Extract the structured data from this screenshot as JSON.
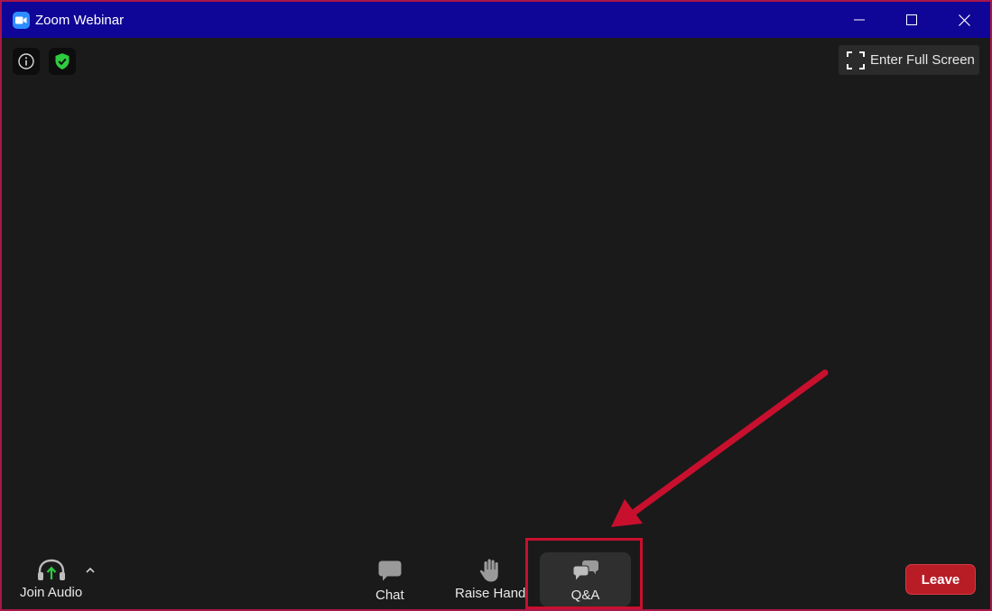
{
  "window": {
    "title": "Zoom Webinar"
  },
  "top_bar": {
    "fullscreen_label": "Enter Full Screen"
  },
  "toolbar": {
    "join_audio_label": "Join Audio",
    "chat_label": "Chat",
    "raise_hand_label": "Raise Hand",
    "qa_label": "Q&A",
    "leave_label": "Leave"
  },
  "icons": {
    "app": "zoom-camera-icon",
    "info": "info-icon",
    "security": "shield-check-icon",
    "fullscreen": "fullscreen-icon",
    "audio": "headphones-icon",
    "chat": "chat-icon",
    "raise_hand": "hand-icon",
    "qa": "qa-icon"
  },
  "colors": {
    "titlebar": "#0f0596",
    "background": "#1a1a1a",
    "leave": "#b81d26",
    "annotation": "#c8102e",
    "audio_arrow": "#2ecc40",
    "security": "#2ecc40"
  }
}
